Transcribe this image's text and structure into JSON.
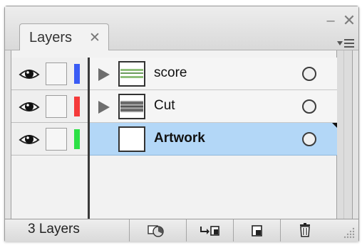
{
  "panel": {
    "tab_label": "Layers",
    "tab_close_glyph": "✕",
    "minimize_glyph": "‒",
    "close_glyph": "✕",
    "menu_icon": "panel-menu-icon"
  },
  "layers": [
    {
      "name": "score",
      "visible": true,
      "expandable": true,
      "selected": false,
      "color": "#3a5cf5",
      "thumbnail": "score-thumbnail"
    },
    {
      "name": "Cut",
      "visible": true,
      "expandable": true,
      "selected": false,
      "color": "#f53a3a",
      "thumbnail": "cut-thumbnail"
    },
    {
      "name": "Artwork",
      "visible": true,
      "expandable": false,
      "selected": true,
      "color": "#2ce045",
      "thumbnail": "blank-thumbnail"
    }
  ],
  "footer": {
    "layer_count": "3 Layers",
    "buttons": [
      "make-clipping-mask-icon",
      "create-sublayer-icon",
      "new-layer-icon",
      "delete-layer-icon"
    ]
  },
  "colors": {
    "selection": "#b3d7f7"
  }
}
